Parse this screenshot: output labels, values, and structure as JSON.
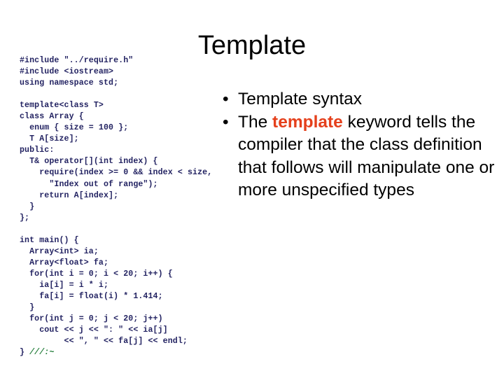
{
  "slide": {
    "title": "Template",
    "background_color": "#ffffff"
  },
  "code": {
    "language": "cpp",
    "text_color": "#232362",
    "comment_color": "#1e7a35",
    "lines": [
      "#include \"../require.h\"",
      "#include <iostream>",
      "using namespace std;",
      "",
      "template<class T>",
      "class Array {",
      "  enum { size = 100 };",
      "  T A[size];",
      "public:",
      "  T& operator[](int index) {",
      "    require(index >= 0 && index < size,",
      "      \"Index out of range\");",
      "    return A[index];",
      "  }",
      "};",
      "",
      "int main() {",
      "  Array<int> ia;",
      "  Array<float> fa;",
      "  for(int i = 0; i < 20; i++) {",
      "    ia[i] = i * i;",
      "    fa[i] = float(i) * 1.414;",
      "  }",
      "  for(int j = 0; j < 20; j++)",
      "    cout << j << \": \" << ia[j]",
      "         << \", \" << fa[j] << endl;",
      "}"
    ],
    "last_line_prefix": "} ",
    "last_line_comment": "///:~"
  },
  "bullets": {
    "marker": "•",
    "accent_color": "#e5401c",
    "items": [
      {
        "id": "bullet-template-syntax",
        "before": "Template syntax",
        "keyword": "",
        "after": ""
      },
      {
        "id": "bullet-template-keyword",
        "before": "The ",
        "keyword": "template",
        "after": " keyword tells the compiler that the class definition that follows will manipulate one or more unspecified types"
      }
    ]
  }
}
